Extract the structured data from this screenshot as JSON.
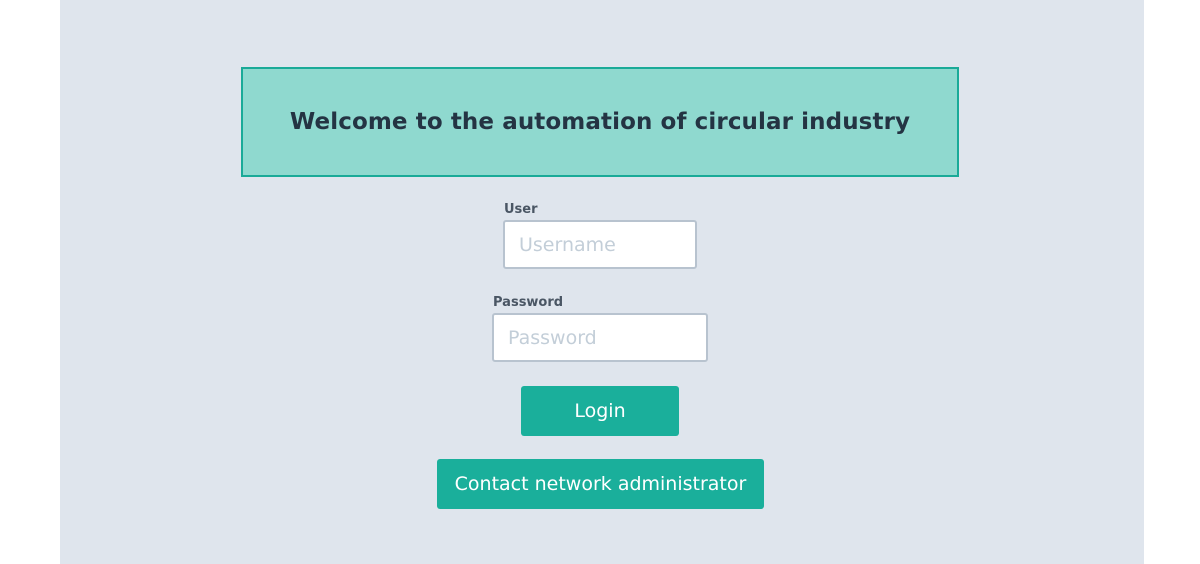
{
  "banner": {
    "title": "Welcome to the automation of circular industry"
  },
  "form": {
    "user_label": "User",
    "username_placeholder": "Username",
    "username_value": "",
    "password_label": "Password",
    "password_placeholder": "Password",
    "password_value": "",
    "login_label": "Login",
    "contact_label": "Contact network administrator"
  },
  "colors": {
    "page_background": "#dfe5ed",
    "banner_fill": "#8fd9cf",
    "banner_border": "#1aaa98",
    "button_fill": "#1aaf9b",
    "title_text": "#243443"
  }
}
